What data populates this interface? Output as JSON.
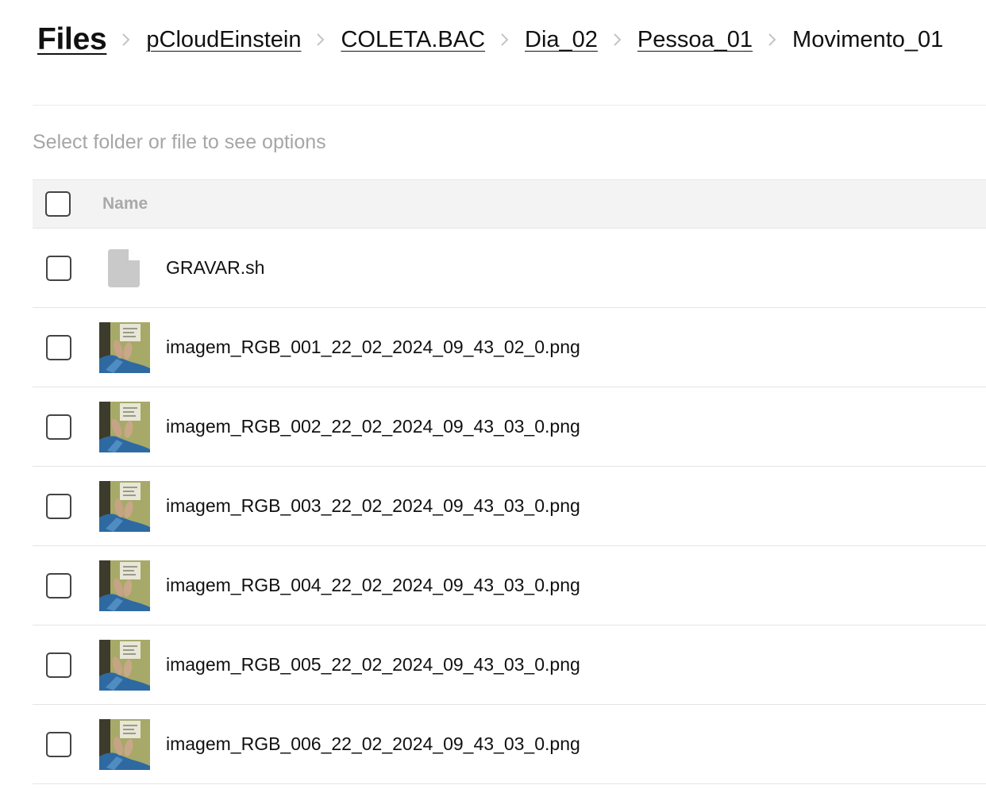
{
  "breadcrumb": {
    "root": "Files",
    "items": [
      {
        "label": "pCloudEinstein"
      },
      {
        "label": "COLETA.BAC"
      },
      {
        "label": "Dia_02"
      },
      {
        "label": "Pessoa_01"
      }
    ],
    "current": "Movimento_01"
  },
  "options": {
    "hint": "Select folder or file to see options"
  },
  "table": {
    "header": {
      "name": "Name"
    },
    "rows": [
      {
        "name": "GRAVAR.sh",
        "icon": "file-icon"
      },
      {
        "name": "imagem_RGB_001_22_02_2024_09_43_02_0.png",
        "icon": "image-thumbnail"
      },
      {
        "name": "imagem_RGB_002_22_02_2024_09_43_03_0.png",
        "icon": "image-thumbnail"
      },
      {
        "name": "imagem_RGB_003_22_02_2024_09_43_03_0.png",
        "icon": "image-thumbnail"
      },
      {
        "name": "imagem_RGB_004_22_02_2024_09_43_03_0.png",
        "icon": "image-thumbnail"
      },
      {
        "name": "imagem_RGB_005_22_02_2024_09_43_03_0.png",
        "icon": "image-thumbnail"
      },
      {
        "name": "imagem_RGB_006_22_02_2024_09_43_03_0.png",
        "icon": "image-thumbnail"
      }
    ]
  },
  "colors": {
    "text": "#111111",
    "muted": "#a6a6a6",
    "header_bg": "#f3f3f3",
    "divider": "#e4e4e4",
    "file_icon": "#c9c9c9"
  }
}
